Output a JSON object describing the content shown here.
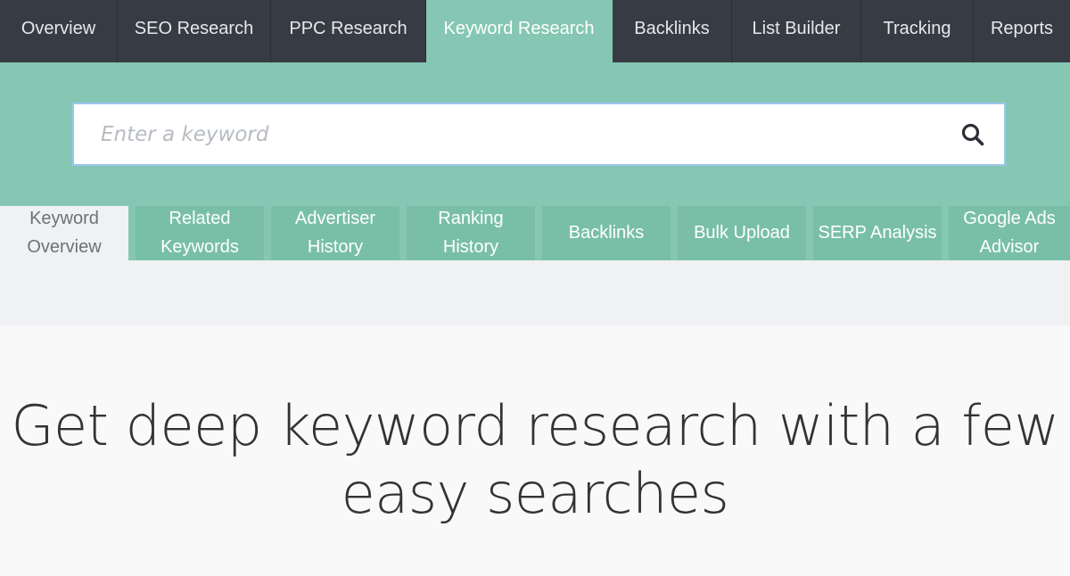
{
  "topnav": {
    "items": [
      {
        "label": "Overview",
        "active": false
      },
      {
        "label": "SEO Research",
        "active": false
      },
      {
        "label": "PPC Research",
        "active": false
      },
      {
        "label": "Keyword Research",
        "active": true
      },
      {
        "label": "Backlinks",
        "active": false
      },
      {
        "label": "List Builder",
        "active": false
      },
      {
        "label": "Tracking",
        "active": false
      },
      {
        "label": "Reports",
        "active": false
      }
    ]
  },
  "search": {
    "placeholder": "Enter a keyword",
    "value": "",
    "icon": "search-icon"
  },
  "subtabs": {
    "items": [
      {
        "line1": "Keyword",
        "line2": "Overview",
        "active": true
      },
      {
        "line1": "Related",
        "line2": "Keywords",
        "active": false
      },
      {
        "line1": "Advertiser",
        "line2": "History",
        "active": false
      },
      {
        "line1": "Ranking",
        "line2": "History",
        "active": false
      },
      {
        "line1": "Backlinks",
        "line2": "",
        "active": false
      },
      {
        "line1": "Bulk Upload",
        "line2": "",
        "active": false
      },
      {
        "line1": "SERP Analysis",
        "line2": "",
        "active": false
      },
      {
        "line1": "Google Ads",
        "line2": "Advisor",
        "active": false
      }
    ]
  },
  "hero": {
    "line1": "Get deep keyword research with a few",
    "line2": "easy searches"
  },
  "colors": {
    "nav_bg": "#373c44",
    "accent_teal": "#85c7b3",
    "subtab_teal": "#79bfa8",
    "page_bg": "#f9f9fa"
  }
}
